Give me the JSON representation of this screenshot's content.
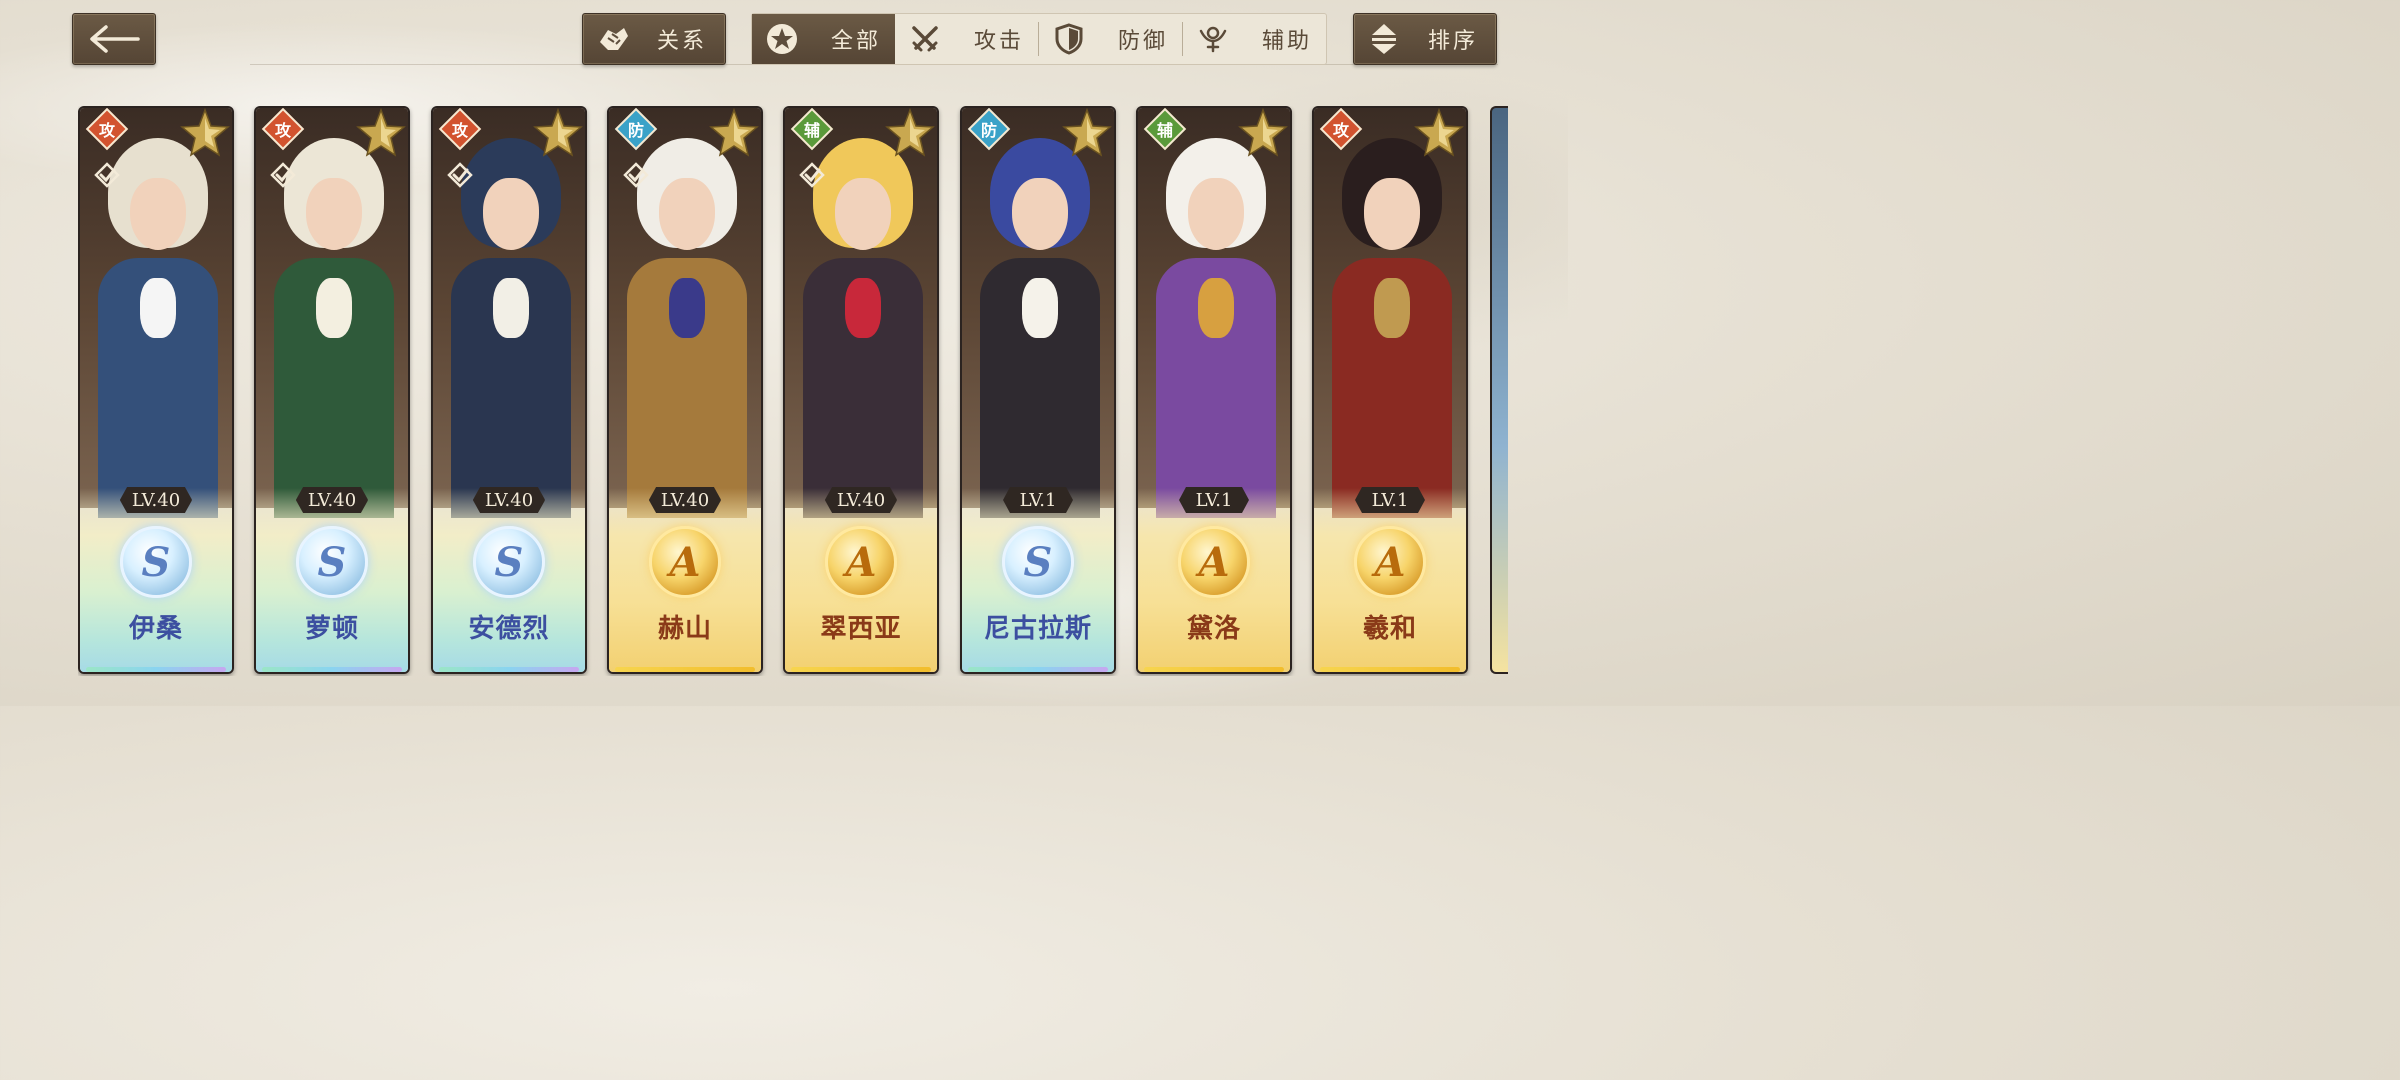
{
  "header": {
    "relation_label": "关系",
    "sort_label": "排序",
    "filters": [
      {
        "label": "全部",
        "icon": "star-circle-icon",
        "active": true
      },
      {
        "label": "攻击",
        "icon": "crossed-swords-icon",
        "active": false
      },
      {
        "label": "防御",
        "icon": "shield-icon",
        "active": false
      },
      {
        "label": "辅助",
        "icon": "support-icon",
        "active": false
      }
    ]
  },
  "colors": {
    "attack": "#d2532f",
    "defense": "#3aa2c8",
    "support": "#5a9a3a",
    "panel_dark": "#5e4e3c"
  },
  "characters": [
    {
      "name": "伊桑",
      "level": "LV.40",
      "rank": "S",
      "role": "攻",
      "role_type": "attack",
      "hair": "#e7e0cf",
      "outfit": "#34507a",
      "accent": "#f5f5f5",
      "checked": true
    },
    {
      "name": "萝顿",
      "level": "LV.40",
      "rank": "S",
      "role": "攻",
      "role_type": "attack",
      "hair": "#ece6d6",
      "outfit": "#2f5a3a",
      "accent": "#f3efe0",
      "checked": true
    },
    {
      "name": "安德烈",
      "level": "LV.40",
      "rank": "S",
      "role": "攻",
      "role_type": "attack",
      "hair": "#2b3b5a",
      "outfit": "#2a3650",
      "accent": "#f2efe6",
      "checked": true
    },
    {
      "name": "赫山",
      "level": "LV.40",
      "rank": "A",
      "role": "防",
      "role_type": "defense",
      "hair": "#f0ede6",
      "outfit": "#a57a3c",
      "accent": "#3a3a8a",
      "checked": true
    },
    {
      "name": "翠西亚",
      "level": "LV.40",
      "rank": "A",
      "role": "辅",
      "role_type": "support",
      "hair": "#f0c85a",
      "outfit": "#3a2e38",
      "accent": "#c8283a",
      "checked": true
    },
    {
      "name": "尼古拉斯",
      "level": "LV.1",
      "rank": "S",
      "role": "防",
      "role_type": "defense",
      "hair": "#3a4aa0",
      "outfit": "#2f2a30",
      "accent": "#f5f2ea",
      "checked": false
    },
    {
      "name": "黛洛",
      "level": "LV.1",
      "rank": "A",
      "role": "辅",
      "role_type": "support",
      "hair": "#f3f0ea",
      "outfit": "#7a4aa0",
      "accent": "#d7a040",
      "checked": false
    },
    {
      "name": "羲和",
      "level": "LV.1",
      "rank": "A",
      "role": "攻",
      "role_type": "attack",
      "hair": "#2a1e1e",
      "outfit": "#8a2a22",
      "accent": "#c09a50",
      "checked": false
    }
  ]
}
